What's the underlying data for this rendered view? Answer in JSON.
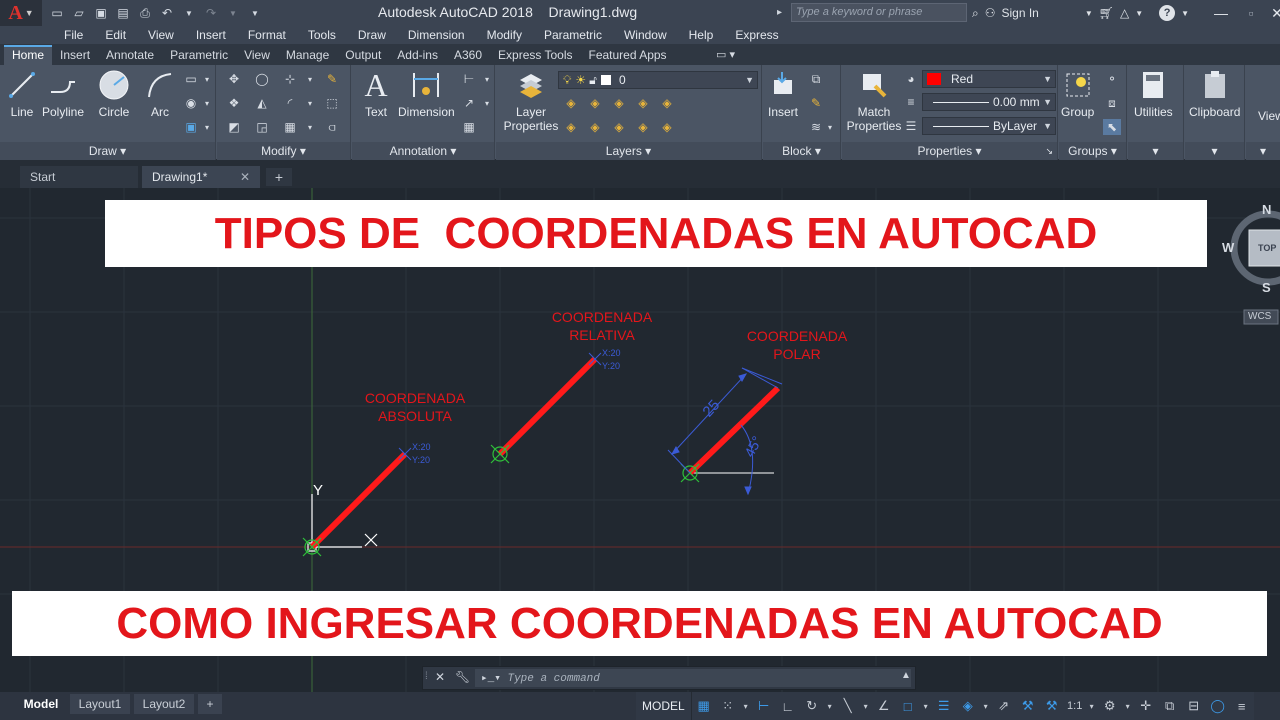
{
  "app": {
    "logo": "A",
    "title": "Autodesk AutoCAD 2018",
    "document": "Drawing1.dwg"
  },
  "titlebar": {
    "search_placeholder": "Type a keyword or phrase",
    "sign_in": "Sign In"
  },
  "menus": [
    "File",
    "Edit",
    "View",
    "Insert",
    "Format",
    "Tools",
    "Draw",
    "Dimension",
    "Modify",
    "Parametric",
    "Window",
    "Help",
    "Express"
  ],
  "ribbon_tabs": [
    "Home",
    "Insert",
    "Annotate",
    "Parametric",
    "View",
    "Manage",
    "Output",
    "Add-ins",
    "A360",
    "Express Tools",
    "Featured Apps"
  ],
  "active_tab": "Home",
  "panels": {
    "draw": {
      "title": "Draw",
      "tools": [
        "Line",
        "Polyline",
        "Circle",
        "Arc"
      ]
    },
    "modify": {
      "title": "Modify"
    },
    "annotation": {
      "title": "Annotation",
      "tools": [
        "Text",
        "Dimension"
      ]
    },
    "layers": {
      "title": "Layers",
      "tool": "Layer Properties",
      "layer_value": "0"
    },
    "block": {
      "title": "Block",
      "tool": "Insert"
    },
    "properties": {
      "title": "Properties",
      "tool": "Match Properties",
      "color": "Red",
      "lineweight": "0.00 mm",
      "linetype": "ByLayer"
    },
    "groups": {
      "title": "Groups",
      "tool": "Group"
    },
    "utilities": {
      "title": "Utilities"
    },
    "clipboard": {
      "title": "Clipboard"
    },
    "view": {
      "title": "View"
    }
  },
  "file_tabs": {
    "start": "Start",
    "drawing": "Drawing1*"
  },
  "canvas": {
    "banner_top": "TIPOS DE  COORDENADAS EN AUTOCAD",
    "banner_bottom": "COMO INGRESAR COORDENADAS EN AUTOCAD",
    "label_absoluta_1": "COORDENADA",
    "label_absoluta_2": "ABSOLUTA",
    "label_relativa_1": "COORDENADA",
    "label_relativa_2": "RELATIVA",
    "label_polar_1": "COORDENADA",
    "label_polar_2": "POLAR",
    "coord_x": "X:20",
    "coord_y": "Y:20",
    "dim_length": "25",
    "dim_angle": "45°",
    "ucs_y": "Y",
    "accent_color": "#e3161b",
    "line_color": "#ff1a1a"
  },
  "viewcube": {
    "n": "N",
    "w": "W",
    "s": "S",
    "top": "TOP",
    "wcs": "WCS"
  },
  "command": {
    "placeholder": "Type a command"
  },
  "status": {
    "layouts": [
      "Model",
      "Layout1",
      "Layout2"
    ],
    "model": "MODEL",
    "scale": "1:1"
  }
}
